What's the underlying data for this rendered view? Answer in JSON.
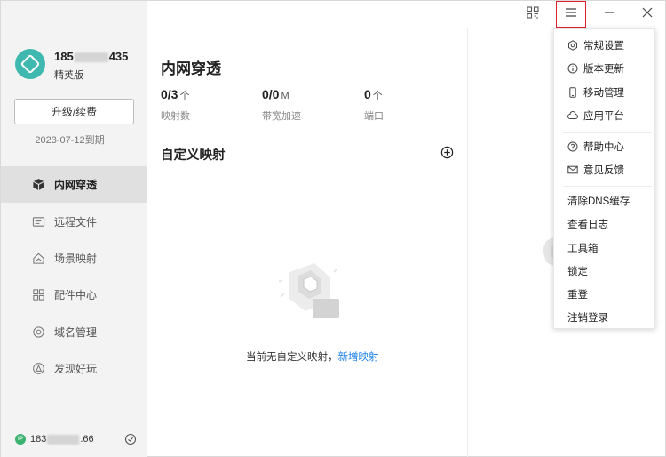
{
  "user": {
    "name_prefix": "185",
    "name_suffix": "435",
    "edition": "精英版",
    "upgrade_label": "升级/续费",
    "expire": "2023-07-12到期"
  },
  "sidebar": {
    "items": [
      {
        "label": "内网穿透",
        "icon": "cube-icon"
      },
      {
        "label": "远程文件",
        "icon": "folder-icon"
      },
      {
        "label": "场景映射",
        "icon": "house-icon"
      },
      {
        "label": "配件中心",
        "icon": "grid-icon"
      },
      {
        "label": "域名管理",
        "icon": "globe-icon"
      },
      {
        "label": "发现好玩",
        "icon": "compass-icon"
      }
    ],
    "ip_badge": "IP",
    "ip_prefix": "183",
    "ip_suffix": ".66"
  },
  "main": {
    "title": "内网穿透",
    "stats": [
      {
        "value": "0/3",
        "unit": "个",
        "label": "映射数"
      },
      {
        "value": "0/0",
        "unit": "M",
        "label": "带宽加速"
      },
      {
        "value": "0",
        "unit": "个",
        "label": "端口"
      }
    ],
    "section_title": "自定义映射",
    "empty_text": "当前无自定义映射，",
    "empty_link": "新增映射"
  },
  "menu": {
    "group1": [
      {
        "label": "常规设置",
        "icon": "gear-icon"
      },
      {
        "label": "版本更新",
        "icon": "info-icon"
      },
      {
        "label": "移动管理",
        "icon": "phone-icon"
      },
      {
        "label": "应用平台",
        "icon": "cloud-icon"
      }
    ],
    "group2": [
      {
        "label": "帮助中心",
        "icon": "help-icon"
      },
      {
        "label": "意见反馈",
        "icon": "mail-icon"
      }
    ],
    "group3": [
      {
        "label": "清除DNS缓存"
      },
      {
        "label": "查看日志"
      },
      {
        "label": "工具箱"
      },
      {
        "label": "锁定"
      },
      {
        "label": "重登"
      },
      {
        "label": "注销登录"
      }
    ]
  }
}
